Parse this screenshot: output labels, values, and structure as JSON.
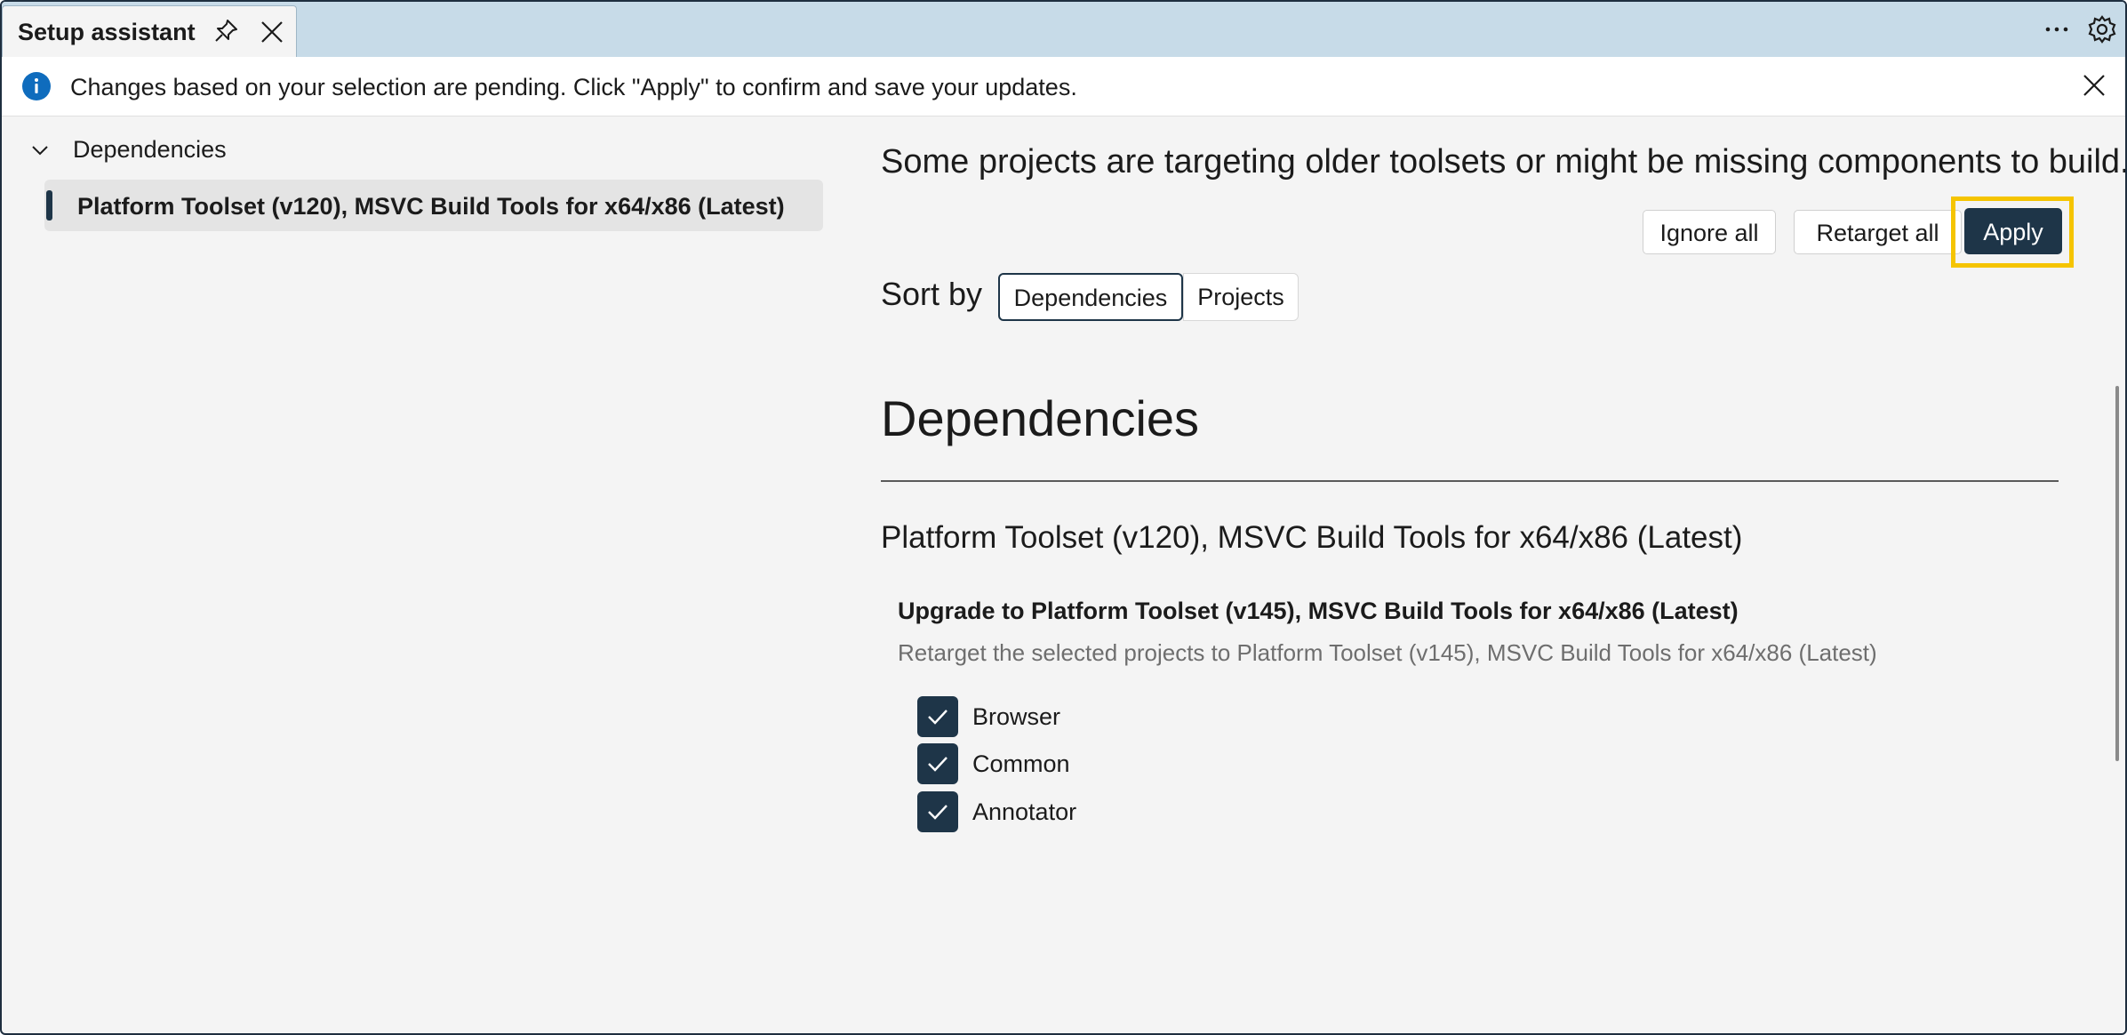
{
  "tab": {
    "title": "Setup assistant"
  },
  "infobar": {
    "message": "Changes based on your selection are pending. Click \"Apply\" to confirm and save your updates."
  },
  "tree": {
    "header": "Dependencies",
    "items": [
      {
        "label": "Platform Toolset (v120), MSVC Build Tools for x64/x86 (Latest)",
        "selected": true
      }
    ]
  },
  "main": {
    "headline": "Some projects are targeting older toolsets or might be missing components to build.",
    "buttons": {
      "ignore_all": "Ignore all",
      "retarget_all": "Retarget all",
      "apply": "Apply"
    },
    "sort": {
      "label": "Sort by",
      "options": [
        "Dependencies",
        "Projects"
      ],
      "selected": "Dependencies"
    },
    "section_title": "Dependencies",
    "group": {
      "title": "Platform Toolset (v120), MSVC Build Tools for x64/x86 (Latest)",
      "upgrade_title": "Upgrade to Platform Toolset (v145), MSVC Build Tools for x64/x86 (Latest)",
      "upgrade_desc": "Retarget the selected projects to Platform Toolset (v145), MSVC Build Tools for x64/x86 (Latest)",
      "projects": [
        {
          "label": "Browser",
          "checked": true
        },
        {
          "label": "Common",
          "checked": true
        },
        {
          "label": "Annotator",
          "checked": true
        }
      ]
    }
  },
  "colors": {
    "accent": "#1e3548",
    "highlight": "#f5c400",
    "info_blue": "#0f6cbd",
    "tabstrip": "#c7dbe8"
  },
  "icons": [
    "pin-icon",
    "close-icon",
    "more-icon",
    "gear-icon",
    "info-icon",
    "chevron-down-icon",
    "checkmark-icon"
  ]
}
